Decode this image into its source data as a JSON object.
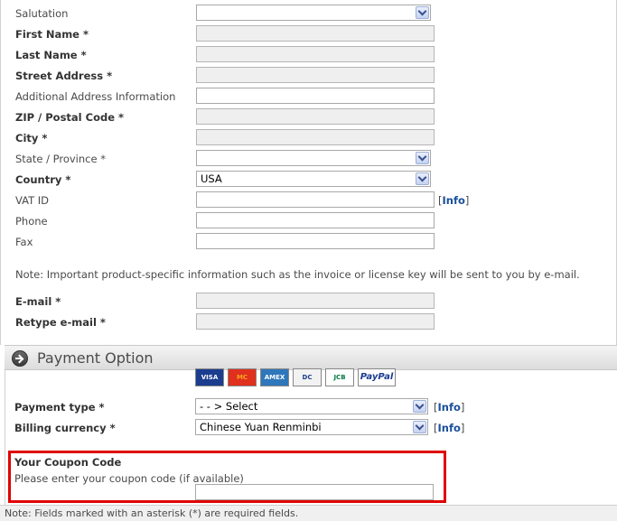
{
  "address_form": {
    "salutation": {
      "label": "Salutation",
      "value": ""
    },
    "first_name": {
      "label": "First Name *",
      "value": ""
    },
    "last_name": {
      "label": "Last Name *",
      "value": ""
    },
    "street": {
      "label": "Street Address *",
      "value": ""
    },
    "additional": {
      "label": "Additional Address Information",
      "value": ""
    },
    "zip": {
      "label": "ZIP / Postal Code *",
      "value": ""
    },
    "city": {
      "label": "City *",
      "value": ""
    },
    "state": {
      "label": "State / Province *",
      "value": ""
    },
    "country": {
      "label": "Country *",
      "value": "USA"
    },
    "vat": {
      "label": "VAT ID",
      "value": "",
      "info_open": "[",
      "info_link": "Info",
      "info_close": "]"
    },
    "phone": {
      "label": "Phone",
      "value": ""
    },
    "fax": {
      "label": "Fax",
      "value": ""
    },
    "note": "Note: Important product-specific information such as the invoice or license key will be sent to you by e-mail.",
    "email": {
      "label": "E-mail *",
      "value": ""
    },
    "retype_email": {
      "label": "Retype e-mail *",
      "value": ""
    }
  },
  "payment": {
    "section_title": "Payment Option",
    "cards": [
      {
        "label": "VISA",
        "bg": "#1a3d8f",
        "fg": "#ffffff"
      },
      {
        "label": "MC",
        "bg": "#e0301e",
        "fg": "#f7a41c"
      },
      {
        "label": "AMEX",
        "bg": "#2e77bb",
        "fg": "#ffffff"
      },
      {
        "label": "DC",
        "bg": "#f2f2f2",
        "fg": "#1a3d8f"
      },
      {
        "label": "JCB",
        "bg": "#ffffff",
        "fg": "#007b40"
      },
      {
        "label": "PayPal",
        "bg": "#ffffff",
        "fg": "#1a3d8f"
      }
    ],
    "payment_type": {
      "label": "Payment type *",
      "value": "- - > Select",
      "info_link": "Info"
    },
    "billing_currency": {
      "label": "Billing currency *",
      "value": "Chinese Yuan Renminbi",
      "info_link": "Info"
    }
  },
  "coupon": {
    "title": "Your Coupon Code",
    "hint": "Please enter your coupon code (if available)",
    "value": ""
  },
  "footer_note": "Note: Fields marked with an asterisk (*) are required fields.",
  "colors": {
    "highlight": "#e00000",
    "link": "#1a4f9c"
  }
}
